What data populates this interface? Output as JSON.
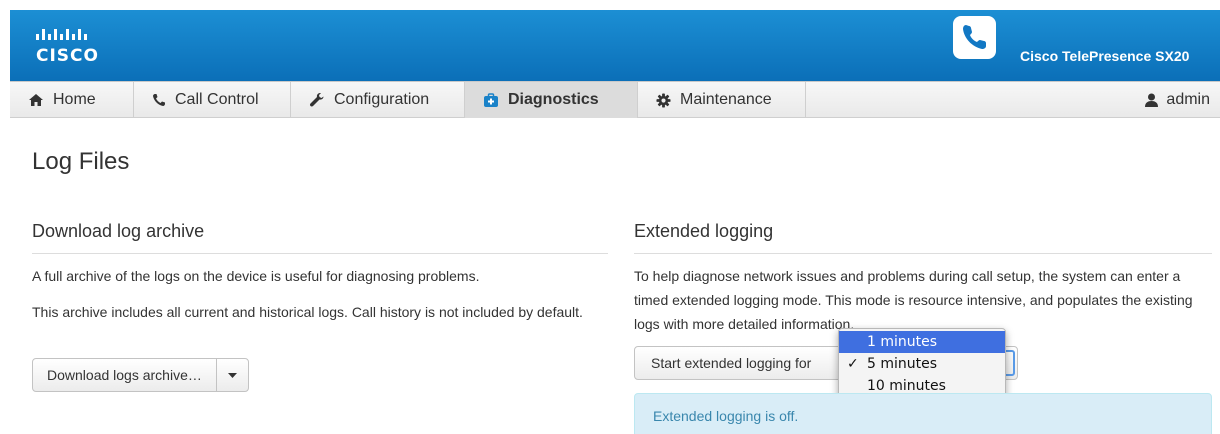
{
  "header": {
    "brand": "CISCO",
    "product": "Cisco TelePresence SX20",
    "bg_color": "#1a82c8"
  },
  "nav": {
    "items": [
      {
        "label": "Home",
        "icon": "home-icon",
        "active": false
      },
      {
        "label": "Call Control",
        "icon": "phone-icon",
        "active": false
      },
      {
        "label": "Configuration",
        "icon": "wrench-icon",
        "active": false
      },
      {
        "label": "Diagnostics",
        "icon": "medkit-icon",
        "active": true
      },
      {
        "label": "Maintenance",
        "icon": "gear-icon",
        "active": false
      }
    ],
    "user": {
      "label": "admin",
      "icon": "user-icon"
    }
  },
  "page": {
    "title": "Log Files"
  },
  "download": {
    "title": "Download log archive",
    "para1": "A full archive of the logs on the device is useful for diagnosing problems.",
    "para2": "This archive includes all current and historical logs. Call history is not included by default.",
    "button_label": "Download logs archive…"
  },
  "extended": {
    "title": "Extended logging",
    "para": "To help diagnose network issues and problems during call setup, the system can enter a timed extended logging mode. This mode is resource intensive, and populates the existing logs with more detailed information.",
    "select_label": "Start extended logging for",
    "options": [
      {
        "label": "1 minutes",
        "highlighted": true,
        "selected": false
      },
      {
        "label": "5 minutes",
        "highlighted": false,
        "selected": true
      },
      {
        "label": "10 minutes",
        "highlighted": false,
        "selected": false
      }
    ],
    "status": "Extended logging is off."
  }
}
